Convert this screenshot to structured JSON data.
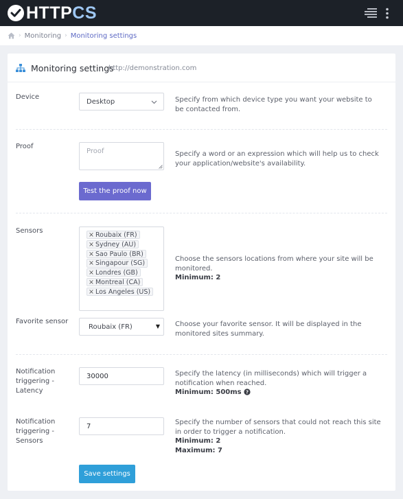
{
  "brand": {
    "name_part1": "HTTP",
    "name_part2": "CS"
  },
  "breadcrumb": {
    "item1": "Monitoring",
    "item2": "Monitoring settings"
  },
  "card": {
    "title": "Monitoring settings",
    "url": "http://demonstration.com"
  },
  "device": {
    "label": "Device",
    "value": "Desktop",
    "help": "Specify from which device type you want your website to be contacted from."
  },
  "proof": {
    "label": "Proof",
    "placeholder": "Proof",
    "help": "Specify a word or an expression which will help us to check your application/website's availability.",
    "button": "Test the proof now"
  },
  "sensors": {
    "label": "Sensors",
    "tags": [
      "Roubaix (FR)",
      "Sydney (AU)",
      "Sao Paulo (BR)",
      "Singapour (SG)",
      "Londres (GB)",
      "Montreal (CA)",
      "Los Angeles (US)"
    ],
    "help": "Choose the sensors locations from where your site will be monitored.",
    "help_strong": "Minimum: 2"
  },
  "favorite": {
    "label": "Favorite sensor",
    "value": "Roubaix (FR)",
    "help": "Choose your favorite sensor. It will be displayed in the monitored sites summary."
  },
  "latency": {
    "label": "Notification triggering - Latency",
    "value": "30000",
    "help": "Specify the latency (in milliseconds) which will trigger a notification when reached.",
    "help_strong": "Minimum: 500ms"
  },
  "sensors_trigger": {
    "label": "Notification triggering - Sensors",
    "value": "7",
    "help": "Specify the number of sensors that could not reach this site in order to trigger a notification.",
    "min": "Minimum: 2",
    "max": "Maximum: 7"
  },
  "save_button": "Save settings",
  "colors": {
    "accent": "#6b6acf",
    "save": "#2f9fd9",
    "topbar": "#1c2128",
    "breadcrumb_active": "#5d69c4"
  }
}
